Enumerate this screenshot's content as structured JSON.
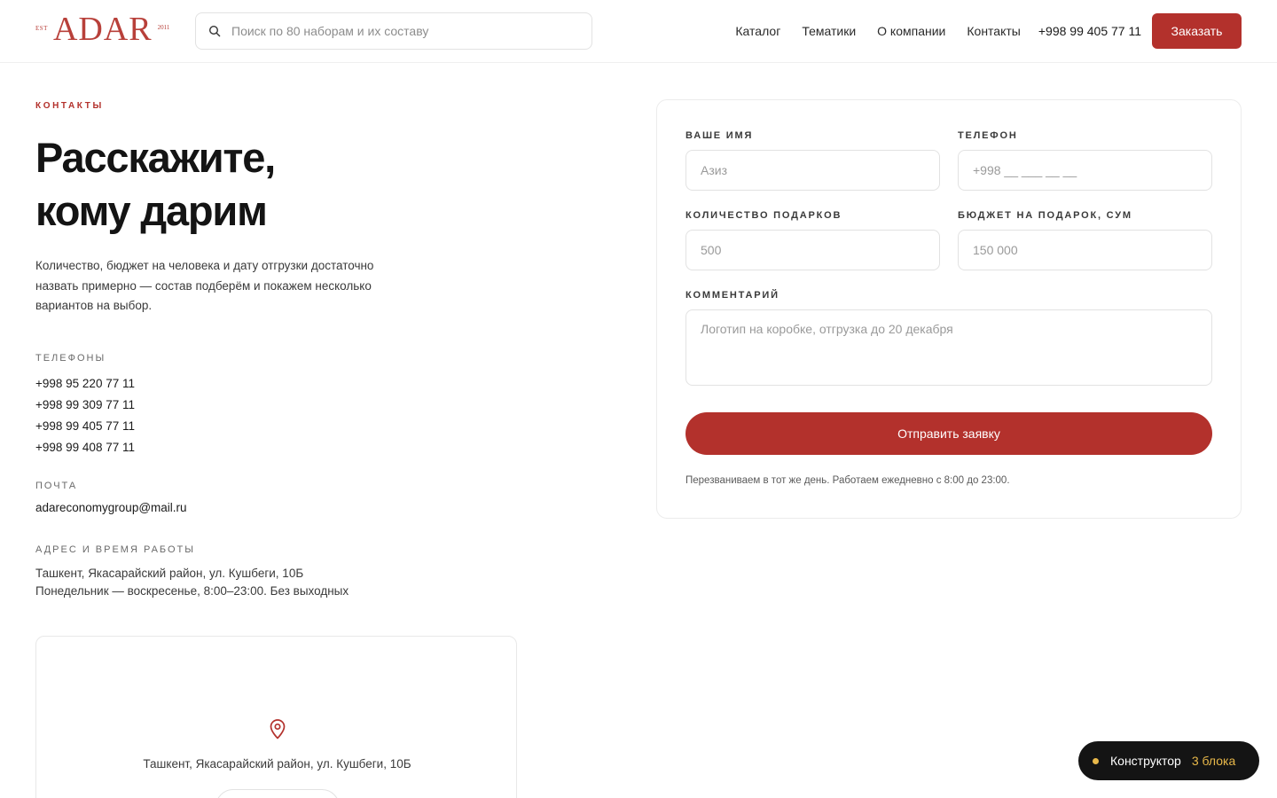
{
  "brand": {
    "est": "EST",
    "name": "ADAR",
    "year": "2011",
    "color": "#b8403a"
  },
  "search": {
    "placeholder": "Поиск по 80 наборам и их составу",
    "icon": "search-icon"
  },
  "nav": {
    "items": [
      "Каталог",
      "Тематики",
      "О компании",
      "Контакты"
    ],
    "phone": "+998 99 405 77 11",
    "order_label": "Заказать"
  },
  "hero": {
    "eyebrow": "КОНТАКТЫ",
    "title_line1": "Расскажите,",
    "title_line2": "кому дарим",
    "lead": "Количество, бюджет на человека и дату отгрузки достаточно назвать примерно — состав подберём и покажем несколько вариантов на выбор."
  },
  "contacts": {
    "phones_label": "ТЕЛЕФОНЫ",
    "phones": [
      "+998 95 220 77 11",
      "+998 99 309 77 11",
      "+998 99 405 77 11",
      "+998 99 408 77 11"
    ],
    "email_label": "ПОЧТА",
    "email": "adareconomygroup@mail.ru",
    "address_label": "АДРЕС И ВРЕМЯ РАБОТЫ",
    "address_line1": "Ташкент, Якасарайский район, ул. Кушбеги, 10Б",
    "address_line2": "Понедельник — воскресенье, 8:00–23:00. Без выходных"
  },
  "map": {
    "pin_icon": "map-pin-icon",
    "address": "Ташкент, Якасарайский район, ул. Кушбеги, 10Б"
  },
  "form": {
    "name_label": "ВАШЕ ИМЯ",
    "name_placeholder": "Азиз",
    "phone_label": "ТЕЛЕФОН",
    "phone_placeholder": "+998 __ ___ __ __",
    "qty_label": "КОЛИЧЕСТВО ПОДАРКОВ",
    "qty_placeholder": "500",
    "budget_label": "БЮДЖЕТ НА ПОДАРОК, СУМ",
    "budget_placeholder": "150 000",
    "comment_label": "КОММЕНТАРИЙ",
    "comment_placeholder": "Логотип на коробке, отгрузка до 20 декабря",
    "submit_label": "Отправить заявку",
    "note": "Перезваниваем в тот же день. Работаем ежедневно с 8:00 до 23:00."
  },
  "constructor": {
    "label": "Конструктор",
    "count": "3 блока",
    "accent": "#e8b84a"
  },
  "colors": {
    "primary": "#b3312c",
    "text": "#1a1a1a",
    "dark_pill": "#141414"
  }
}
